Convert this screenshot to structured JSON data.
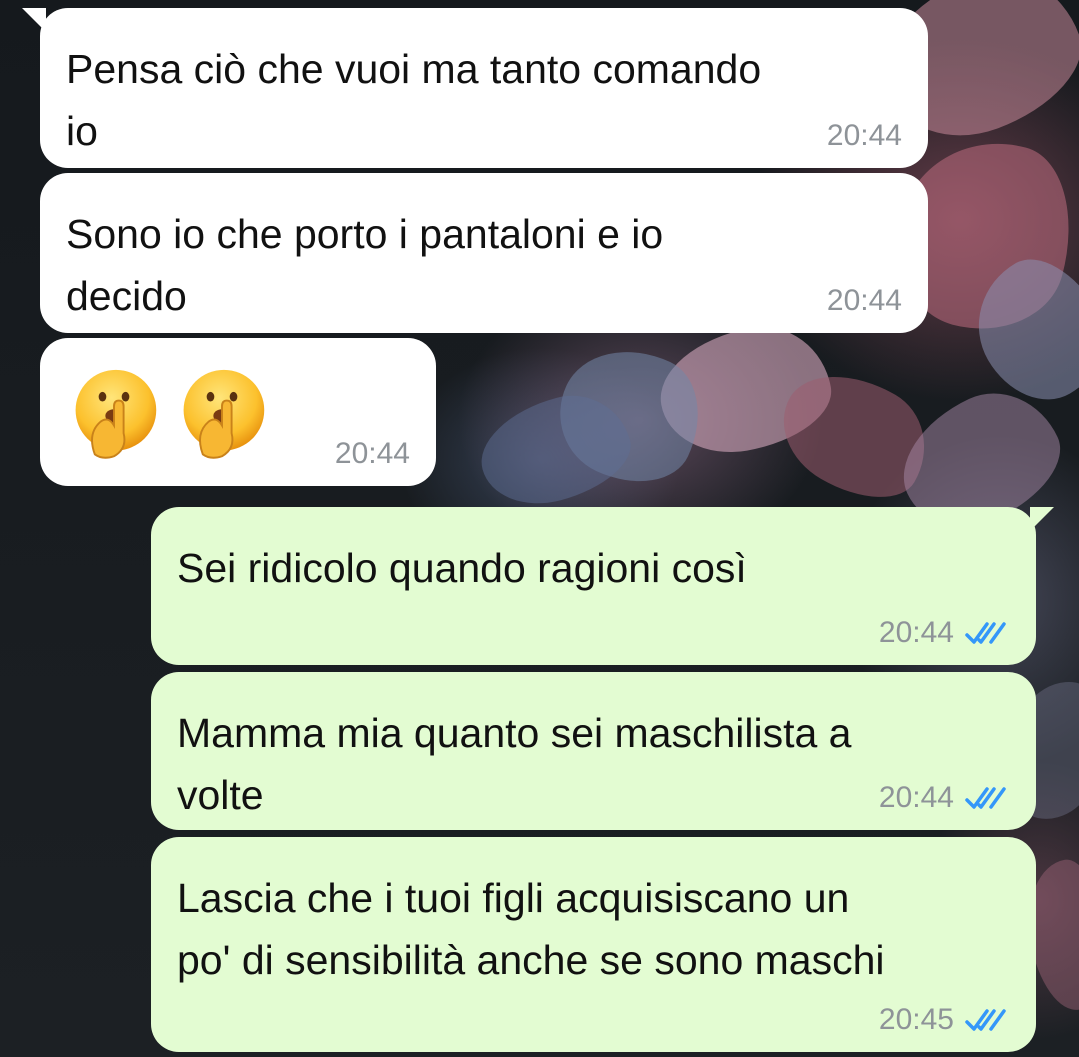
{
  "messages": [
    {
      "direction": "incoming",
      "text": "Pensa ciò che vuoi ma tanto comando\nio",
      "time": "20:44"
    },
    {
      "direction": "incoming",
      "text": "Sono io che porto i pantaloni e io\ndecido",
      "time": "20:44"
    },
    {
      "direction": "incoming",
      "emojis": [
        "shushing-face-emoji",
        "shushing-face-emoji"
      ],
      "time": "20:44"
    },
    {
      "direction": "outgoing",
      "text": "Sei ridicolo quando ragioni così",
      "time": "20:44",
      "status": "read"
    },
    {
      "direction": "outgoing",
      "text": "Mamma mia quanto sei maschilista a\nvolte",
      "time": "20:44",
      "status": "read"
    },
    {
      "direction": "outgoing",
      "text": "Lascia che i tuoi figli acquisiscano un\npo' di sensibilità anche se sono maschi",
      "time": "20:45",
      "status": "read"
    }
  ],
  "colors": {
    "incoming_bubble": "#ffffff",
    "outgoing_bubble": "#e3fcd2",
    "timestamp": "#8e9398",
    "read_ticks": "#3497f9"
  }
}
